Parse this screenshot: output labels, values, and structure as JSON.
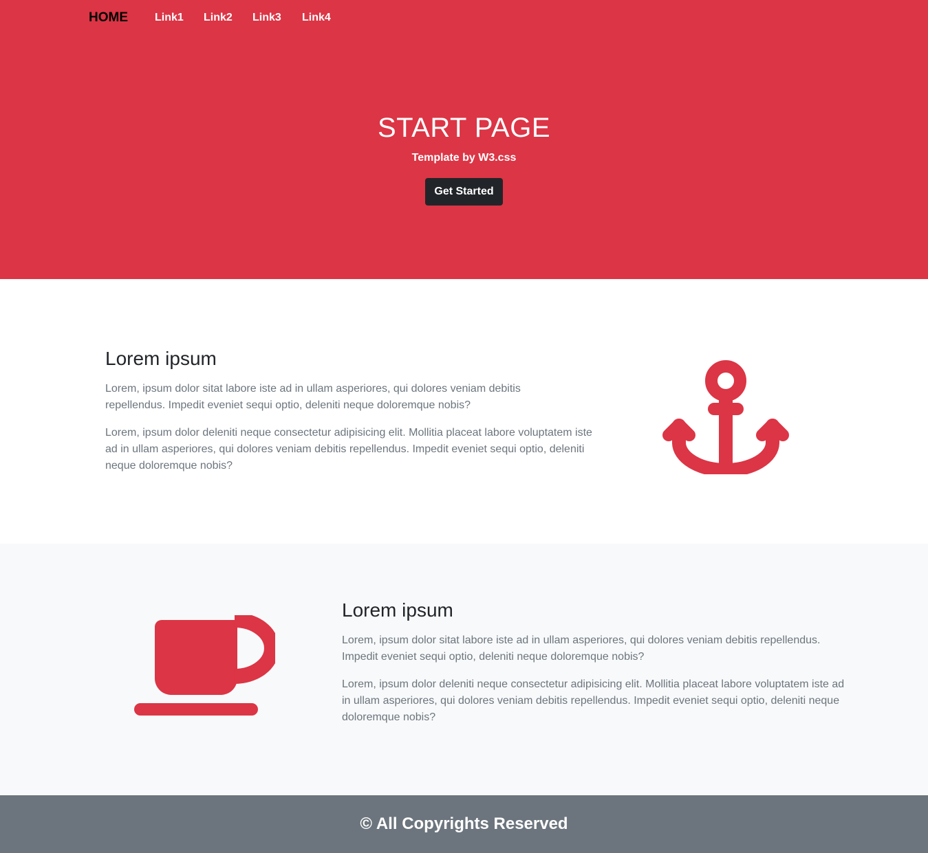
{
  "nav": {
    "home": "HOME",
    "links": [
      "Link1",
      "Link2",
      "Link3",
      "Link4"
    ]
  },
  "hero": {
    "title": "START PAGE",
    "subtitle": "Template by W3.css",
    "button": "Get Started"
  },
  "section_one": {
    "heading": "Lorem ipsum",
    "paragraph_1": "Lorem, ipsum dolor sitat labore iste ad in ullam asperiores, qui dolores veniam debitis repellendus. Impedit eveniet sequi optio, deleniti neque doloremque nobis?",
    "paragraph_2": "Lorem, ipsum dolor deleniti neque consectetur adipisicing elit. Mollitia placeat labore voluptatem iste ad in ullam asperiores, qui dolores veniam debitis repellendus. Impedit eveniet sequi optio, deleniti neque doloremque nobis?",
    "icon": "anchor-icon"
  },
  "section_two": {
    "heading": "Lorem ipsum",
    "paragraph_1": "Lorem, ipsum dolor sitat labore iste ad in ullam asperiores, qui dolores veniam debitis repellendus. Impedit eveniet sequi optio, deleniti neque doloremque nobis?",
    "paragraph_2": "Lorem, ipsum dolor deleniti neque consectetur adipisicing elit. Mollitia placeat labore voluptatem iste ad in ullam asperiores, qui dolores veniam debitis repellendus. Impedit eveniet sequi optio, deleniti neque doloremque nobis?",
    "icon": "coffee-cup-icon"
  },
  "footer": {
    "text": "© All Copyrights Reserved"
  },
  "colors": {
    "accent": "#dc3545",
    "dark": "#212529",
    "muted": "#6c757d",
    "light_bg": "#f8f9fa"
  }
}
